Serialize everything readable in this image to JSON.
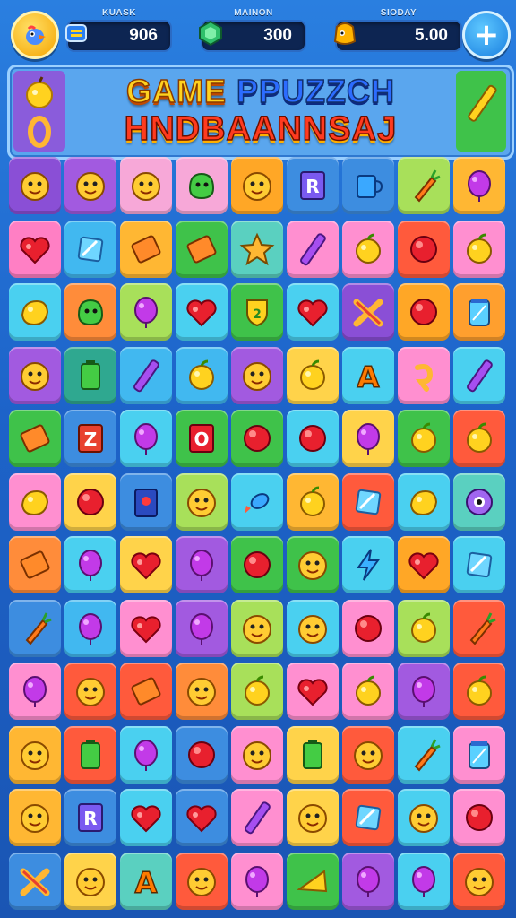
{
  "topbar": {
    "stat1": {
      "label": "KUASK",
      "value": "906",
      "icon": "card-icon"
    },
    "stat2": {
      "label": "MAINON",
      "value": "300",
      "icon": "gem-icon"
    },
    "stat3": {
      "label": "SIODAY",
      "value": "5.00",
      "icon": "coin-pouch-icon"
    },
    "profile_icon": "profile-bird-icon",
    "add_icon": "plus-icon"
  },
  "header": {
    "title_line1_a": "GAME ",
    "title_line1_b": "PPUZZCH",
    "title_line2": "HNDBAANNSAJ",
    "left_icons": [
      "apple-icon",
      "ring-icon"
    ],
    "right_icon": "pencil-icon"
  },
  "colors": {
    "accent": "#1d63c9",
    "title_yellow": "#ffd21f",
    "title_blue": "#2c6cff",
    "title_red": "#ff3b1f"
  },
  "board": {
    "rows": [
      [
        [
          "#8a4fd6",
          "face"
        ],
        [
          "#a25ae0",
          "face"
        ],
        [
          "#f7a8d8",
          "face"
        ],
        [
          "#f7a8d8",
          "blob"
        ],
        [
          "#ffa726",
          "face"
        ],
        [
          "#3d8de0",
          "letterR"
        ],
        [
          "#3d8de0",
          "cup"
        ],
        [
          "#a8e05a",
          "carrot"
        ],
        [
          "#ffb733",
          "balloon"
        ]
      ],
      [
        [
          "#ff7fc4",
          "heart"
        ],
        [
          "#41b8f0",
          "gem"
        ],
        [
          "#ffb733",
          "block"
        ],
        [
          "#3fc24a",
          "block"
        ],
        [
          "#5ad0c0",
          "star"
        ],
        [
          "#ff8fd0",
          "pencil"
        ],
        [
          "#ff8fd0",
          "apple"
        ],
        [
          "#ff5a3c",
          "ball"
        ],
        [
          "#ff8fd0",
          "apple"
        ]
      ],
      [
        [
          "#4ad0f0",
          "lemon"
        ],
        [
          "#ff8c3a",
          "blob"
        ],
        [
          "#a8e05a",
          "balloon"
        ],
        [
          "#4ad0f0",
          "heart"
        ],
        [
          "#3fc24a",
          "shield"
        ],
        [
          "#4ad0f0",
          "heart"
        ],
        [
          "#8a4fd6",
          "cross"
        ],
        [
          "#ffa726",
          "ball"
        ],
        [
          "#ff9f2e",
          "jar"
        ]
      ],
      [
        [
          "#a25ae0",
          "face"
        ],
        [
          "#2fa890",
          "battery"
        ],
        [
          "#41b8f0",
          "pencil"
        ],
        [
          "#41b8f0",
          "apple"
        ],
        [
          "#a25ae0",
          "face"
        ],
        [
          "#ffd34a",
          "apple"
        ],
        [
          "#4ad0f0",
          "letterA"
        ],
        [
          "#ff8fd0",
          "swirl"
        ],
        [
          "#4ad0f0",
          "pencil"
        ]
      ],
      [
        [
          "#3fc24a",
          "block"
        ],
        [
          "#3d8de0",
          "letterZ"
        ],
        [
          "#4ad0f0",
          "balloon"
        ],
        [
          "#3fc24a",
          "letterO"
        ],
        [
          "#3fc24a",
          "ball"
        ],
        [
          "#4ad0f0",
          "ball"
        ],
        [
          "#ffd34a",
          "balloon"
        ],
        [
          "#3fc24a",
          "apple"
        ],
        [
          "#ff5a3c",
          "apple"
        ]
      ],
      [
        [
          "#ff8fd0",
          "lemon"
        ],
        [
          "#ffd34a",
          "ball"
        ],
        [
          "#3d8de0",
          "box"
        ],
        [
          "#a8e05a",
          "face"
        ],
        [
          "#4ad0f0",
          "fish"
        ],
        [
          "#ffb733",
          "apple"
        ],
        [
          "#ff5a3c",
          "gem"
        ],
        [
          "#4ad0f0",
          "lemon"
        ],
        [
          "#5ad0c0",
          "eye"
        ]
      ],
      [
        [
          "#ff8c3a",
          "block"
        ],
        [
          "#4ad0f0",
          "balloon"
        ],
        [
          "#ffd34a",
          "heart"
        ],
        [
          "#a25ae0",
          "balloon"
        ],
        [
          "#3fc24a",
          "ball"
        ],
        [
          "#3fc24a",
          "face"
        ],
        [
          "#4ad0f0",
          "bolt"
        ],
        [
          "#ffa726",
          "heart"
        ],
        [
          "#4ad0f0",
          "gem"
        ]
      ],
      [
        [
          "#3d8de0",
          "carrot"
        ],
        [
          "#41b8f0",
          "balloon"
        ],
        [
          "#ff8fd0",
          "heart"
        ],
        [
          "#a25ae0",
          "balloon"
        ],
        [
          "#a8e05a",
          "face"
        ],
        [
          "#4ad0f0",
          "face"
        ],
        [
          "#ff8fd0",
          "ball"
        ],
        [
          "#a8e05a",
          "apple"
        ],
        [
          "#ff5a3c",
          "carrot"
        ]
      ],
      [
        [
          "#ff8fd0",
          "balloon"
        ],
        [
          "#ff5a3c",
          "face"
        ],
        [
          "#ff5a3c",
          "block"
        ],
        [
          "#ff8c3a",
          "face"
        ],
        [
          "#a8e05a",
          "apple"
        ],
        [
          "#ff8fd0",
          "heart"
        ],
        [
          "#ff8fd0",
          "apple"
        ],
        [
          "#a25ae0",
          "balloon"
        ],
        [
          "#ff5a3c",
          "apple"
        ]
      ],
      [
        [
          "#ffb733",
          "face"
        ],
        [
          "#ff5a3c",
          "battery"
        ],
        [
          "#4ad0f0",
          "balloon"
        ],
        [
          "#3d8de0",
          "ball"
        ],
        [
          "#ff8fd0",
          "face"
        ],
        [
          "#ffd34a",
          "battery"
        ],
        [
          "#ff5a3c",
          "face"
        ],
        [
          "#4ad0f0",
          "carrot"
        ],
        [
          "#ff8fd0",
          "jar"
        ]
      ],
      [
        [
          "#ffb733",
          "face"
        ],
        [
          "#3d8de0",
          "letterR"
        ],
        [
          "#4ad0f0",
          "heart"
        ],
        [
          "#3d8de0",
          "heart"
        ],
        [
          "#ff8fd0",
          "pencil"
        ],
        [
          "#ffd34a",
          "face"
        ],
        [
          "#ff5a3c",
          "gem"
        ],
        [
          "#4ad0f0",
          "face"
        ],
        [
          "#ff8fd0",
          "ball"
        ]
      ],
      [
        [
          "#3d8de0",
          "cross"
        ],
        [
          "#ffd34a",
          "face"
        ],
        [
          "#5ad0c0",
          "letterA"
        ],
        [
          "#ff5a3c",
          "face"
        ],
        [
          "#ff8fd0",
          "balloon"
        ],
        [
          "#3fc24a",
          "cheese"
        ],
        [
          "#a25ae0",
          "balloon"
        ],
        [
          "#4ad0f0",
          "balloon"
        ],
        [
          "#ff5a3c",
          "face"
        ]
      ]
    ]
  }
}
